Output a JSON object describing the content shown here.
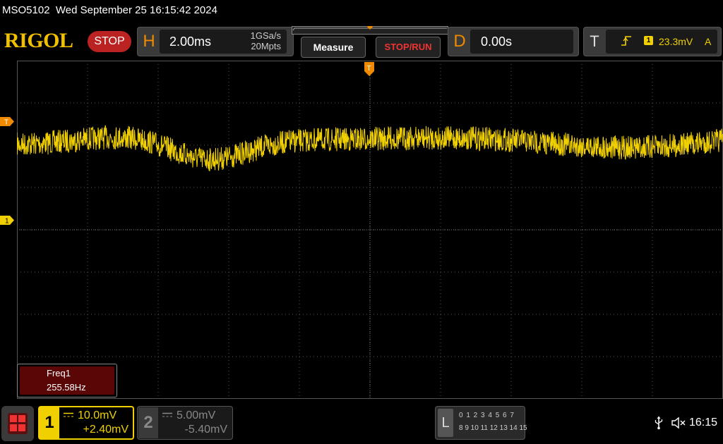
{
  "status_line": {
    "model": "MSO5102",
    "datetime": "Wed September 25 16:15:42 2024"
  },
  "brand": {
    "logo": "RIGOL",
    "run_state": "STOP"
  },
  "horizontal": {
    "label": "H",
    "scale": "2.00ms",
    "sample_rate": "1GSa/s",
    "memory_depth": "20Mpts"
  },
  "buttons": {
    "measure": "Measure",
    "stop_run": "STOP/RUN"
  },
  "delay": {
    "label": "D",
    "value": "0.00s"
  },
  "trigger": {
    "label": "T",
    "edge_icon": "rising-edge-icon",
    "source": "1",
    "level": "23.3mV",
    "mode": "A"
  },
  "markers": {
    "trigger_level": "T",
    "ch1_ground": "1",
    "trigger_position": "T"
  },
  "measurement": {
    "name": "Freq1",
    "value": "255.58Hz"
  },
  "channel1": {
    "number": "1",
    "coupling_icon": "dc-coupling-icon",
    "scale": "10.0mV",
    "offset": "+2.40mV",
    "color": "#f0d000"
  },
  "channel2": {
    "number": "2",
    "coupling_icon": "dc-coupling-icon",
    "scale": "5.00mV",
    "offset": "-5.40mV",
    "color": "#888888"
  },
  "logic": {
    "label": "L",
    "row1": "0 1 2 3  4 5 6 7",
    "row2": "8 9 10 11 12 13 14 15"
  },
  "system": {
    "usb_icon": "usb-icon",
    "sound_icon": "speaker-muted-icon",
    "time": "16:15"
  },
  "colors": {
    "accent": "#f08a00",
    "trace": "#f0d000",
    "stop": "#b22222"
  }
}
